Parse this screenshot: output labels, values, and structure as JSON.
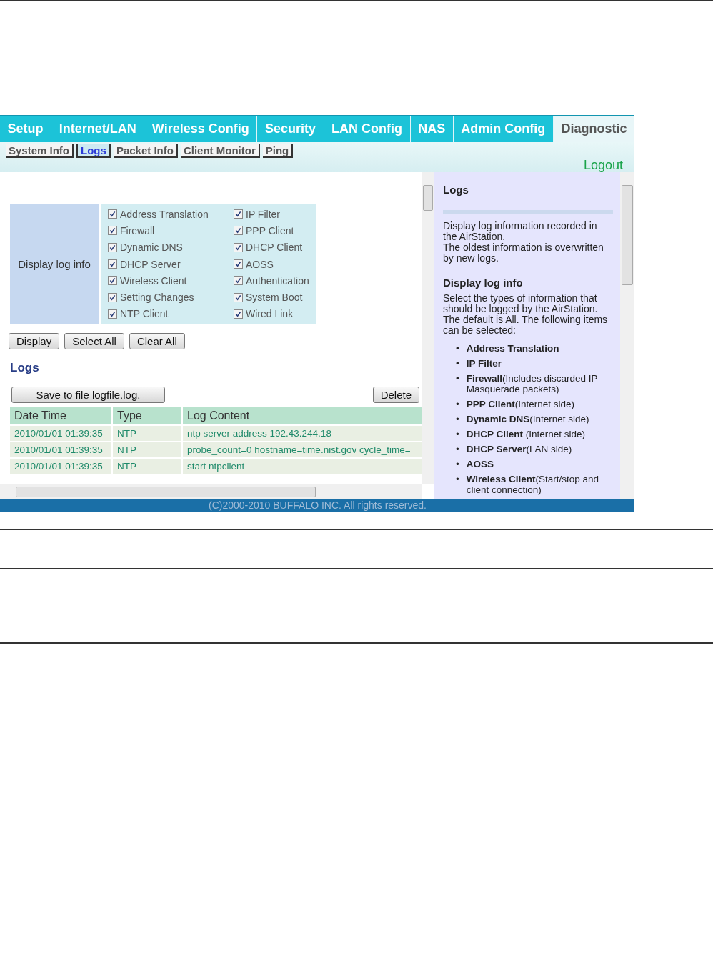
{
  "tabs": [
    {
      "label": "Setup",
      "selected": false
    },
    {
      "label": "Internet/LAN",
      "selected": false
    },
    {
      "label": "Wireless Config",
      "selected": false
    },
    {
      "label": "Security",
      "selected": false
    },
    {
      "label": "LAN Config",
      "selected": false
    },
    {
      "label": "NAS",
      "selected": false
    },
    {
      "label": "Admin Config",
      "selected": false
    },
    {
      "label": "Diagnostic",
      "selected": true
    }
  ],
  "subtabs": [
    {
      "label": "System Info",
      "selected": false
    },
    {
      "label": "Logs",
      "selected": true
    },
    {
      "label": "Packet Info",
      "selected": false
    },
    {
      "label": "Client Monitor",
      "selected": false
    },
    {
      "label": "Ping",
      "selected": false
    }
  ],
  "logout": "Logout",
  "log_options": {
    "label": "Display log info",
    "items": [
      {
        "label": "Address Translation",
        "checked": true
      },
      {
        "label": "IP Filter",
        "checked": true
      },
      {
        "label": "Firewall",
        "checked": true
      },
      {
        "label": "PPP Client",
        "checked": true
      },
      {
        "label": "Dynamic DNS",
        "checked": true
      },
      {
        "label": "DHCP Client",
        "checked": true
      },
      {
        "label": "DHCP Server",
        "checked": true
      },
      {
        "label": "AOSS",
        "checked": true
      },
      {
        "label": "Wireless Client",
        "checked": true
      },
      {
        "label": "Authentication",
        "checked": true
      },
      {
        "label": "Setting Changes",
        "checked": true
      },
      {
        "label": "System Boot",
        "checked": true
      },
      {
        "label": "NTP Client",
        "checked": true
      },
      {
        "label": "Wired Link",
        "checked": true
      }
    ]
  },
  "option_buttons": [
    "Display",
    "Select All",
    "Clear All"
  ],
  "logs_heading": "Logs",
  "save_button": "Save to file logfile.log.",
  "delete_button": "Delete",
  "table": {
    "columns": [
      "Date Time",
      "Type",
      "Log Content"
    ],
    "rows": [
      [
        "2010/01/01 01:39:35",
        "NTP",
        "ntp server address 192.43.244.18"
      ],
      [
        "2010/01/01 01:39:35",
        "NTP",
        "probe_count=0 hostname=time.nist.gov cycle_time="
      ],
      [
        "2010/01/01 01:39:35",
        "NTP",
        "start ntpclient"
      ]
    ]
  },
  "help": {
    "title": "Logs",
    "intro": [
      "Display log information recorded in the AirStation.",
      "The oldest information is overwritten by new logs."
    ],
    "heading": "Display log info",
    "bullet": "•",
    "text": "Select the types of information that should be logged by the AirStation. The default is All. The following items can be selected:",
    "items": [
      "**Address Translation**",
      "**IP Filter**",
      "**Firewall**(Includes discarded IP Masquerade packets)",
      "**PPP Client**(Internet side)",
      "**Dynamic DNS**(Internet side)",
      "**DHCP Client** (Internet side)",
      "**DHCP Server**(LAN side)",
      "**AOSS**",
      "**Wireless Client**(Start/stop and client connection)"
    ]
  },
  "footer": "(C)2000-2010 BUFFALO INC. All rights reserved."
}
